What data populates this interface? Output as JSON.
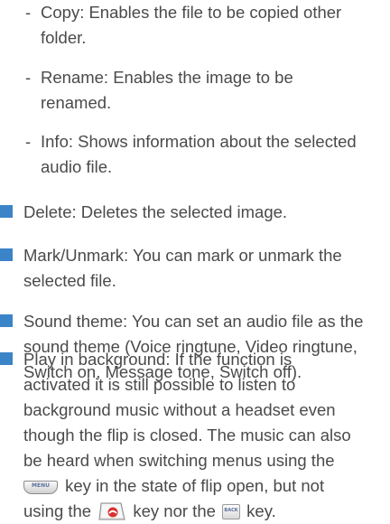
{
  "sub_items": [
    {
      "dash": "-",
      "line1": "Copy: Enables the file to be copied other",
      "line2": "folder."
    },
    {
      "dash": "-",
      "line1": "Rename: Enables the image to be",
      "line2": "renamed."
    },
    {
      "dash": "-",
      "line1": "Info: Shows information about the selected",
      "line2": "audio file."
    }
  ],
  "bullets": [
    {
      "lines": [
        "Delete: Deletes the selected image."
      ]
    },
    {
      "lines": [
        "Mark/Unmark: You can mark or unmark the",
        "selected file."
      ]
    },
    {
      "lines": [
        "Sound theme: You can set an audio file as the",
        "sound theme (Voice ringtune, Video ringtune,",
        "Switch on, Message tone, Switch off)."
      ]
    },
    {
      "lines": [
        "Play in background: If the function is",
        "activated it is still possible to listen to",
        "background music without a headset even",
        "though the flip is closed. The music can also",
        "be heard when switching menus using the"
      ],
      "line6_after_menu": " key in the state of flip open, but not",
      "line7_before_end": "using the ",
      "line7_between": " key nor the ",
      "line7_after_back": " key."
    }
  ],
  "keys": {
    "menu_label": "MENU",
    "back_label": "BACK",
    "menu_icon": "menu-key-icon",
    "end_icon": "end-key-icon",
    "back_icon": "back-key-icon"
  },
  "colors": {
    "bullet": "#3c84c8",
    "text": "#4a4a4a"
  }
}
